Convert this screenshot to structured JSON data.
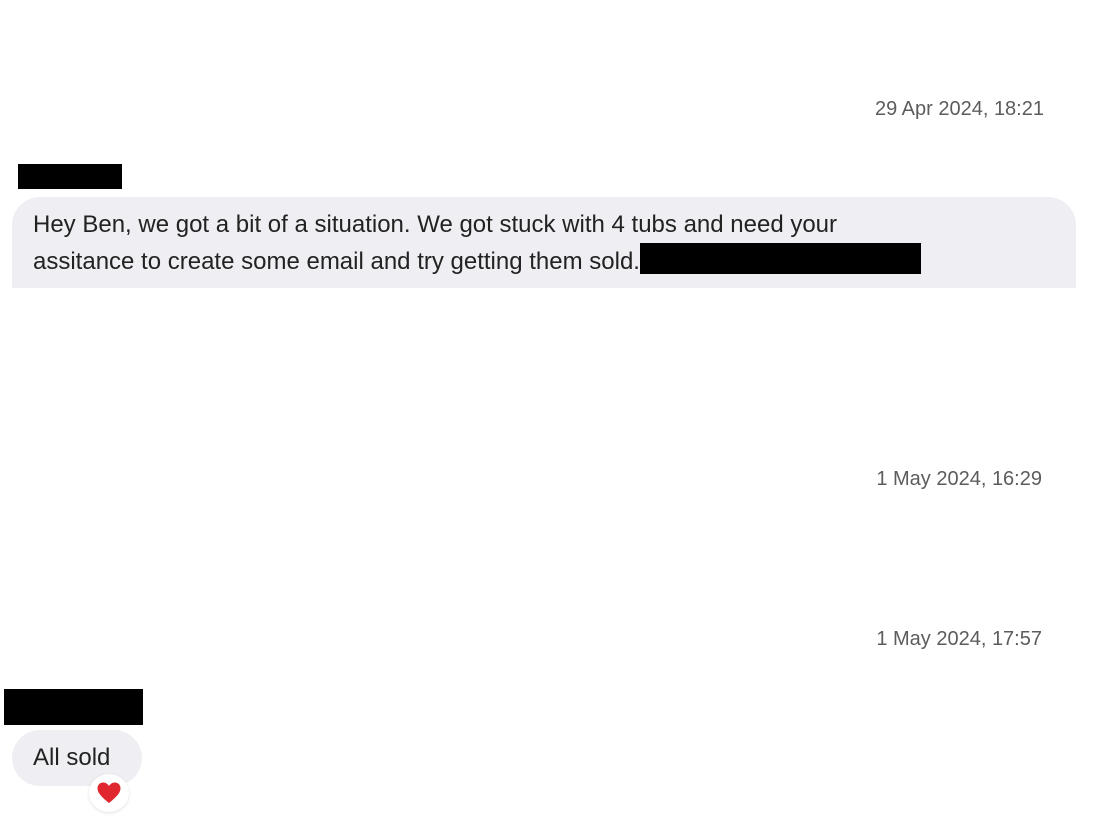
{
  "conversation": {
    "timestamps": [
      "29 Apr 2024, 18:21",
      "1 May 2024, 16:29",
      "1 May 2024, 17:57"
    ],
    "messages": [
      {
        "sender_redacted": true,
        "lines": [
          "Hey Ben, we got a bit of a situation. We got stuck with 4 tubs and need your",
          "assitance to create some email and try getting them sold."
        ],
        "trailing_redacted": true
      },
      {
        "sender_redacted": true,
        "text": "All sold",
        "reaction": "heart-icon",
        "reaction_color": "#e0262f"
      }
    ],
    "bubble_color": "#efeef2",
    "timestamp_color": "#5c5c5c"
  }
}
